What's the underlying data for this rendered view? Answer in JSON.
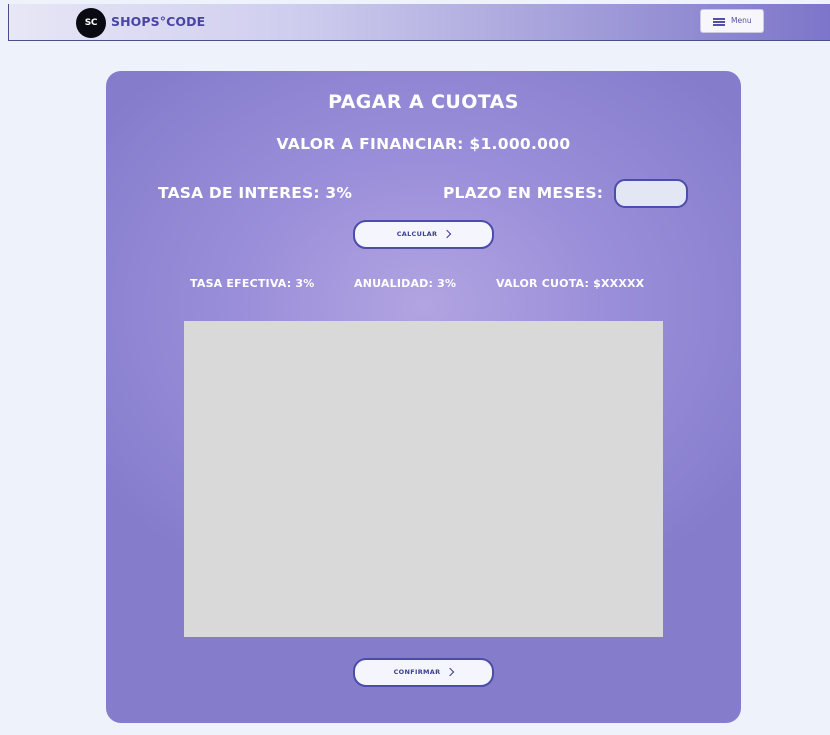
{
  "header": {
    "logo_text": "SC",
    "brand": "SHOPS°CODE",
    "menu_label": "Menu"
  },
  "card": {
    "title": "PAGAR A CUOTAS",
    "amount_text": "VALOR A FINANCIAR: $1.000.000",
    "rate_text": "TASA DE INTERES: 3%",
    "term_label": "PLAZO EN MESES:",
    "term_value": "",
    "calculate_label": "CALCULAR",
    "results": {
      "effective_rate": "TASA EFECTIVA: 3%",
      "annuity": "ANUALIDAD: 3%",
      "installment": "VALOR CUOTA: $XXXXX"
    },
    "confirm_label": "CONFIRMAR"
  },
  "colors": {
    "accent": "#4b4da8",
    "card_gradient_center": "#b2a4e1",
    "card_gradient_edge": "#857dcc",
    "results_panel": "#d9d9d9"
  },
  "icons": {
    "menu": "hamburger-icon",
    "button_arrow": "chevron-right-icon"
  }
}
